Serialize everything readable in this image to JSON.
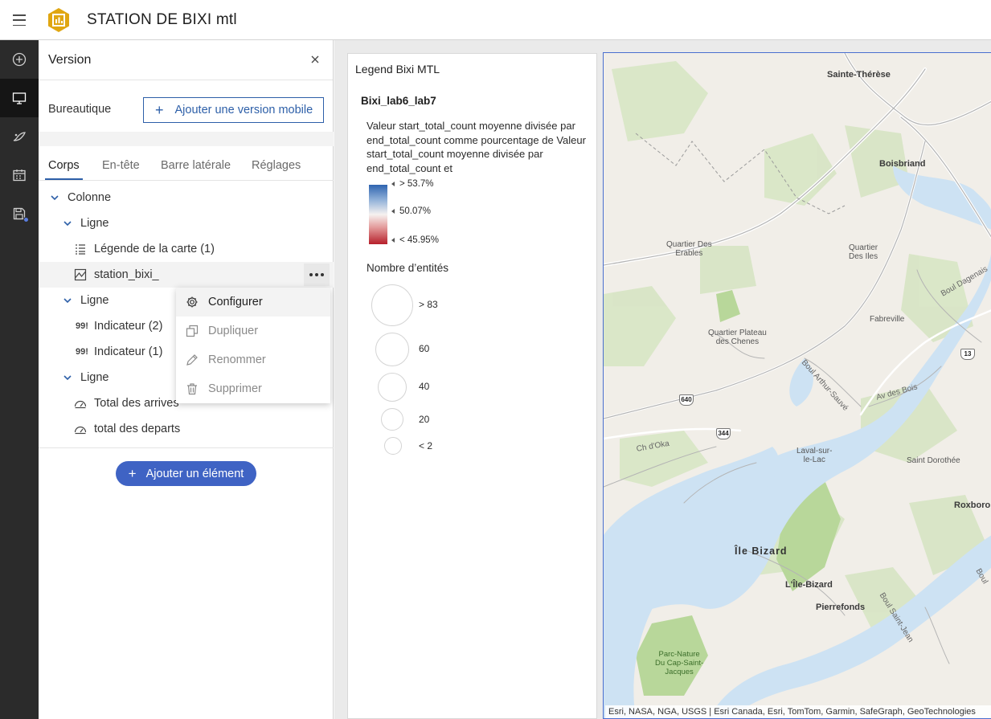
{
  "app": {
    "title": "STATION DE BIXI mtl"
  },
  "rail": {
    "items": [
      "add-icon",
      "monitor-icon",
      "theme-icon",
      "calendar-icon",
      "save-icon"
    ],
    "active": "monitor-icon"
  },
  "panel": {
    "title": "Version",
    "desktop_label": "Bureautique",
    "add_mobile_label": "Ajouter une version mobile",
    "tabs": [
      "Corps",
      "En-tête",
      "Barre latérale",
      "Réglages"
    ],
    "active_tab": "Corps",
    "tree": {
      "column": "Colonne",
      "row1": "Ligne",
      "row1_items": [
        "Légende de la carte (1)",
        "station_bixi_"
      ],
      "row2": "Ligne",
      "row2_items": [
        "Indicateur (2)",
        "Indicateur (1)"
      ],
      "row3": "Ligne",
      "row3_items": [
        "Total des arrives",
        "total des departs"
      ],
      "indicator_glyph": "99!"
    },
    "add_element_label": "Ajouter un élément"
  },
  "context_menu": {
    "items": [
      "Configurer",
      "Dupliquer",
      "Renommer",
      "Supprimer"
    ]
  },
  "legend": {
    "title": "Legend Bixi MTL",
    "layer": "Bixi_lab6_lab7",
    "field_description": "Valeur start_total_count moyenne divisée par end_total_count comme pourcentage de Valeur start_total_count moyenne divisée par end_total_count et",
    "ramp_labels": [
      "> 53.7%",
      "50.07%",
      "< 45.95%"
    ],
    "ramp_colors": [
      "#2f64b0",
      "#f6f2f0",
      "#b6202b"
    ],
    "size_title": "Nombre d’entités",
    "size_labels": [
      "> 83",
      "60",
      "40",
      "20",
      "< 2"
    ]
  },
  "map": {
    "labels": {
      "sainte_therese": "Sainte-Thérèse",
      "boisbriand": "Boisbriand",
      "quartier_erables": "Quartier Des\nErables",
      "quartier_iles": "Quartier\nDes Iles",
      "boul_dagenais": "Boul Dagenais",
      "fabreville": "Fabreville",
      "quartier_plateau": "Quartier Plateau\ndes Chenes",
      "boul_arthur": "Boul Arthur-Sauvé",
      "av_des_bois": "Av des Bois",
      "ch_oka": "Ch d'Oka",
      "laval_sur_le_lac": "Laval-sur-\nle-Lac",
      "saint_dorothee": "Saint Dorothée",
      "roxboro": "Roxboro",
      "ile_bizard": "Île Bizard",
      "l_ile_bizard": "L'Île-Bizard",
      "pierrefonds": "Pierrefonds",
      "boul_saint_jean": "Boul Saint-Jean",
      "boul_partial": "Boul",
      "parc_nature": "Parc-Nature\nDu Cap-Saint-\nJacques"
    },
    "shields": [
      "640",
      "344",
      "13"
    ],
    "attribution": "Esri, NASA, NGA, USGS | Esri Canada, Esri, TomTom, Garmin, SafeGraph, GeoTechnologies"
  }
}
